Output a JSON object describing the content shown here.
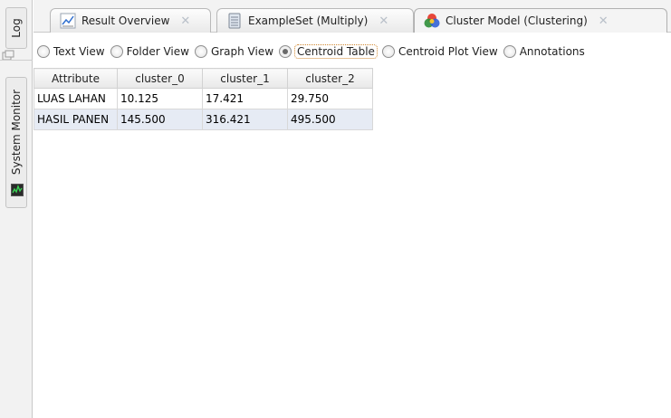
{
  "side_panel": {
    "log_tab": "Log",
    "monitor_tab": "System Monitor"
  },
  "tabs": [
    {
      "label": "Result Overview",
      "icon": "chart-icon",
      "active": false
    },
    {
      "label": "ExampleSet (Multiply)",
      "icon": "database-icon",
      "active": false
    },
    {
      "label": "Cluster Model (Clustering)",
      "icon": "cluster-icon",
      "active": true
    }
  ],
  "views": [
    {
      "label": "Text View",
      "selected": false
    },
    {
      "label": "Folder View",
      "selected": false
    },
    {
      "label": "Graph View",
      "selected": false
    },
    {
      "label": "Centroid Table",
      "selected": true
    },
    {
      "label": "Centroid Plot View",
      "selected": false
    },
    {
      "label": "Annotations",
      "selected": false
    }
  ],
  "centroid_table": {
    "headers": [
      "Attribute",
      "cluster_0",
      "cluster_1",
      "cluster_2"
    ],
    "rows": [
      [
        "LUAS LAHAN",
        "10.125",
        "17.421",
        "29.750"
      ],
      [
        "HASIL PANEN",
        "145.500",
        "316.421",
        "495.500"
      ]
    ]
  },
  "colors": {
    "alt_row": "#e6ebf4",
    "focus_outline": "#d1872f"
  }
}
